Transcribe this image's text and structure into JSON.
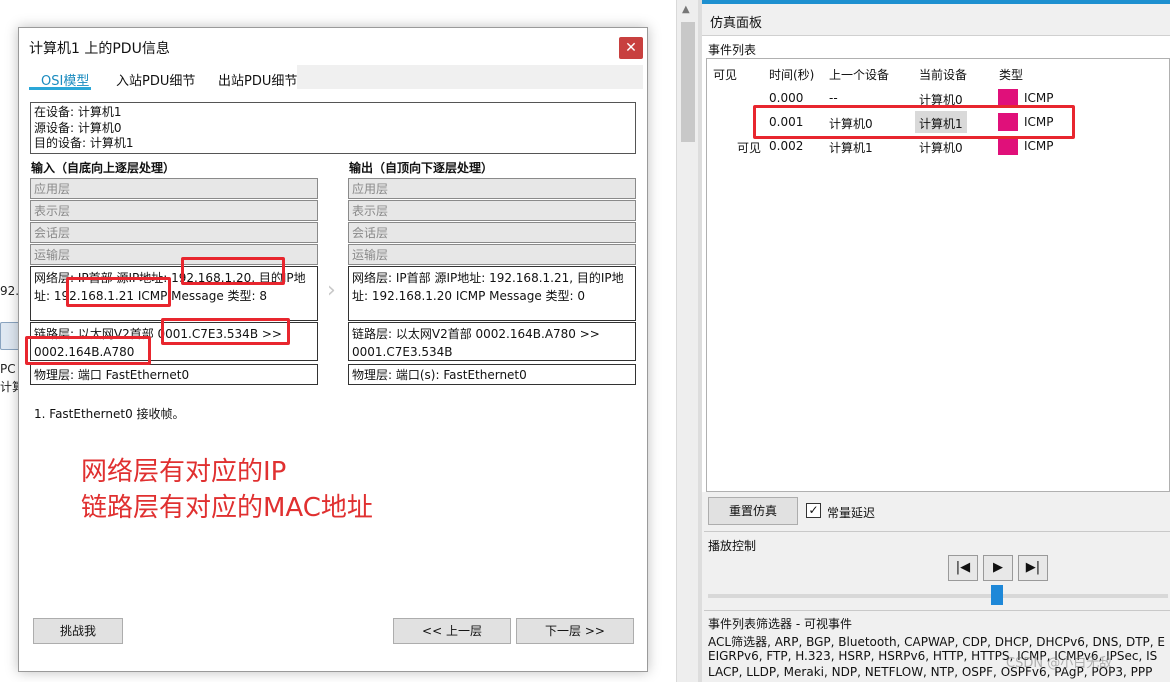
{
  "background": {
    "frag_ip": "92.1",
    "frag_pc": "PC",
    "frag_computer": "计算"
  },
  "dialog": {
    "title": "计算机1 上的PDU信息",
    "close_glyph": "✕",
    "tabs": [
      "OSI模型",
      "入站PDU细节",
      "出站PDU细节"
    ],
    "info": [
      "在设备: 计算机1",
      "源设备: 计算机0",
      "目的设备: 计算机1"
    ],
    "input_header": "输入（自底向上逐层处理）",
    "output_header": "输出（自顶向下逐层处理）",
    "input_layers": {
      "app": "应用层",
      "pres": "表示层",
      "sess": "会话层",
      "trans": "运输层",
      "net": "网络层: IP首部 源IP地址: 192.168.1.20, 目的IP地址: 192.168.1.21 ICMP Message 类型: 8",
      "link": "链路层: 以太网V2首部 0001.C7E3.534B >> 0002.164B.A780",
      "phys": "物理层: 端口 FastEthernet0"
    },
    "output_layers": {
      "app": "应用层",
      "pres": "表示层",
      "sess": "会话层",
      "trans": "运输层",
      "net": "网络层: IP首部 源IP地址: 192.168.1.21, 目的IP地址: 192.168.1.20 ICMP Message 类型: 0",
      "link": "链路层: 以太网V2首部 0002.164B.A780 >> 0001.C7E3.534B",
      "phys": "物理层: 端口(s): FastEthernet0"
    },
    "step_text": "1. FastEthernet0 接收帧。",
    "annotation_line1": "网络层有对应的IP",
    "annotation_line2": "链路层有对应的MAC地址",
    "challenge_button": "挑战我",
    "prev_button": "<< 上一层",
    "next_button": "下一层 >>"
  },
  "sim": {
    "title": "仿真面板",
    "event_list_label": "事件列表",
    "columns": [
      "可见",
      "时间(秒)",
      "上一个设备",
      "当前设备",
      "类型"
    ],
    "events": [
      {
        "visible": "",
        "time": "0.000",
        "last": "--",
        "current": "计算机0",
        "type": "ICMP",
        "color": "#e0107a"
      },
      {
        "visible": "",
        "time": "0.001",
        "last": "计算机0",
        "current": "计算机1",
        "type": "ICMP",
        "color": "#e0107a"
      },
      {
        "visible": "可见",
        "time": "0.002",
        "last": "计算机1",
        "current": "计算机0",
        "type": "ICMP",
        "color": "#e0107a"
      }
    ],
    "reset_button": "重置仿真",
    "constant_delay_label": "常量延迟",
    "constant_delay_checked": true,
    "playback_label": "播放控制",
    "filter_title": "事件列表筛选器 - 可视事件",
    "filter_lines": [
      "ACL筛选器, ARP, BGP, Bluetooth, CAPWAP, CDP, DHCP, DHCPv6, DNS, DTP, E",
      "EIGRPv6, FTP, H.323, HSRP, HSRPv6, HTTP, HTTPS, ICMP, ICMPv6, IPSec, IS",
      "LACP, LLDP, Meraki, NDP, NETFLOW, NTP, OSPF, OSPFv6, PAgP, POP3, PPP"
    ],
    "watermark": "CSDN @小白无敌"
  }
}
